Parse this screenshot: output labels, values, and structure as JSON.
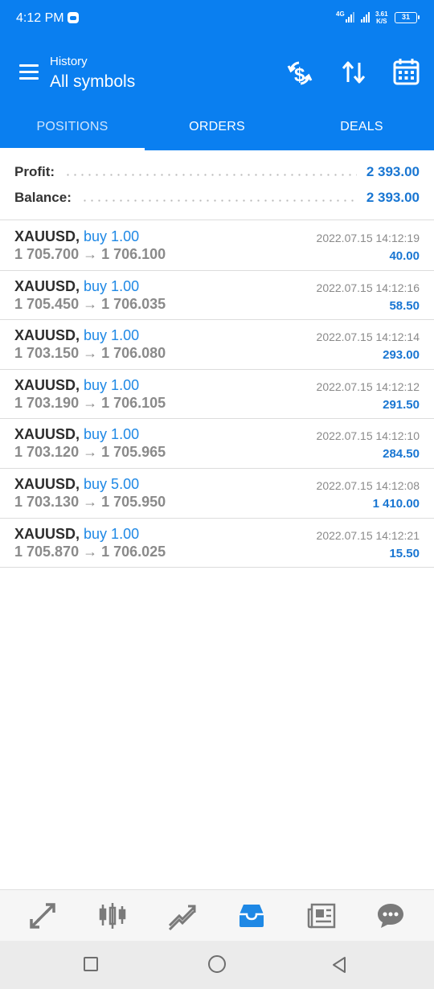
{
  "status_bar": {
    "time": "4:12 PM",
    "network": "4G",
    "speed_value": "3.61",
    "speed_unit": "K/S",
    "battery": "31"
  },
  "app_bar": {
    "subtitle": "History",
    "title": "All symbols",
    "icons": [
      "menu-icon",
      "currency-exchange-icon",
      "sort-arrows-icon",
      "calendar-icon"
    ]
  },
  "tabs": [
    {
      "label": "POSITIONS",
      "active": true
    },
    {
      "label": "ORDERS",
      "active": false
    },
    {
      "label": "DEALS",
      "active": false
    }
  ],
  "summary": {
    "profit_label": "Profit:",
    "profit_value": "2 393.00",
    "balance_label": "Balance:",
    "balance_value": "2 393.00"
  },
  "positions": [
    {
      "symbol": "XAUUSD,",
      "type": "buy 1.00",
      "prices": "1 705.700 → 1 706.100",
      "time": "2022.07.15 14:12:19",
      "profit": "40.00"
    },
    {
      "symbol": "XAUUSD,",
      "type": "buy 1.00",
      "prices": "1 705.450 → 1 706.035",
      "time": "2022.07.15 14:12:16",
      "profit": "58.50"
    },
    {
      "symbol": "XAUUSD,",
      "type": "buy 1.00",
      "prices": "1 703.150 → 1 706.080",
      "time": "2022.07.15 14:12:14",
      "profit": "293.00"
    },
    {
      "symbol": "XAUUSD,",
      "type": "buy 1.00",
      "prices": "1 703.190 → 1 706.105",
      "time": "2022.07.15 14:12:12",
      "profit": "291.50"
    },
    {
      "symbol": "XAUUSD,",
      "type": "buy 1.00",
      "prices": "1 703.120 → 1 705.965",
      "time": "2022.07.15 14:12:10",
      "profit": "284.50"
    },
    {
      "symbol": "XAUUSD,",
      "type": "buy 5.00",
      "prices": "1 703.130 → 1 705.950",
      "time": "2022.07.15 14:12:08",
      "profit": "1 410.00"
    },
    {
      "symbol": "XAUUSD,",
      "type": "buy 1.00",
      "prices": "1 705.870 → 1 706.025",
      "time": "2022.07.15 14:12:21",
      "profit": "15.50"
    }
  ],
  "bottom_nav": [
    "quotes-icon",
    "chart-icon",
    "trade-icon",
    "history-icon",
    "news-icon",
    "chat-icon"
  ],
  "colors": {
    "primary": "#0a7ff0",
    "accent_text": "#1976d2",
    "active_nav": "#1e88e5"
  }
}
